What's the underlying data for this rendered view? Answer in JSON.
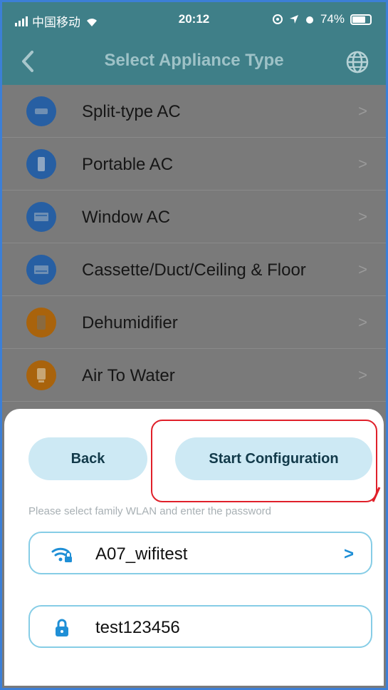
{
  "status_bar": {
    "carrier": "中国移动",
    "time": "20:12",
    "battery": "74%"
  },
  "header": {
    "title": "Select Appliance Type",
    "back_icon": "chevron-left-icon",
    "right_icon": "globe-icon"
  },
  "appliances": [
    {
      "label": "Split-type AC",
      "icon": "split-ac-icon",
      "color": "#275fa3"
    },
    {
      "label": "Portable AC",
      "icon": "portable-ac-icon",
      "color": "#275fa3"
    },
    {
      "label": "Window AC",
      "icon": "window-ac-icon",
      "color": "#275fa3"
    },
    {
      "label": "Cassette/Duct/Ceiling & Floor",
      "icon": "cassette-ac-icon",
      "color": "#275fa3"
    },
    {
      "label": "Dehumidifier",
      "icon": "dehumidifier-icon",
      "color": "#a9630c"
    },
    {
      "label": "Air To Water",
      "icon": "air-to-water-icon",
      "color": "#a9630c"
    }
  ],
  "sheet": {
    "back_label": "Back",
    "start_label": "Start Configuration",
    "hint": "Please select family WLAN and enter the password",
    "wifi_name": "A07_wifitest",
    "password": "test123456"
  },
  "colors": {
    "accent": "#86cde6",
    "button_bg": "#cde9f4",
    "header_bg": "#3f7f88",
    "highlight": "#e0202a"
  }
}
